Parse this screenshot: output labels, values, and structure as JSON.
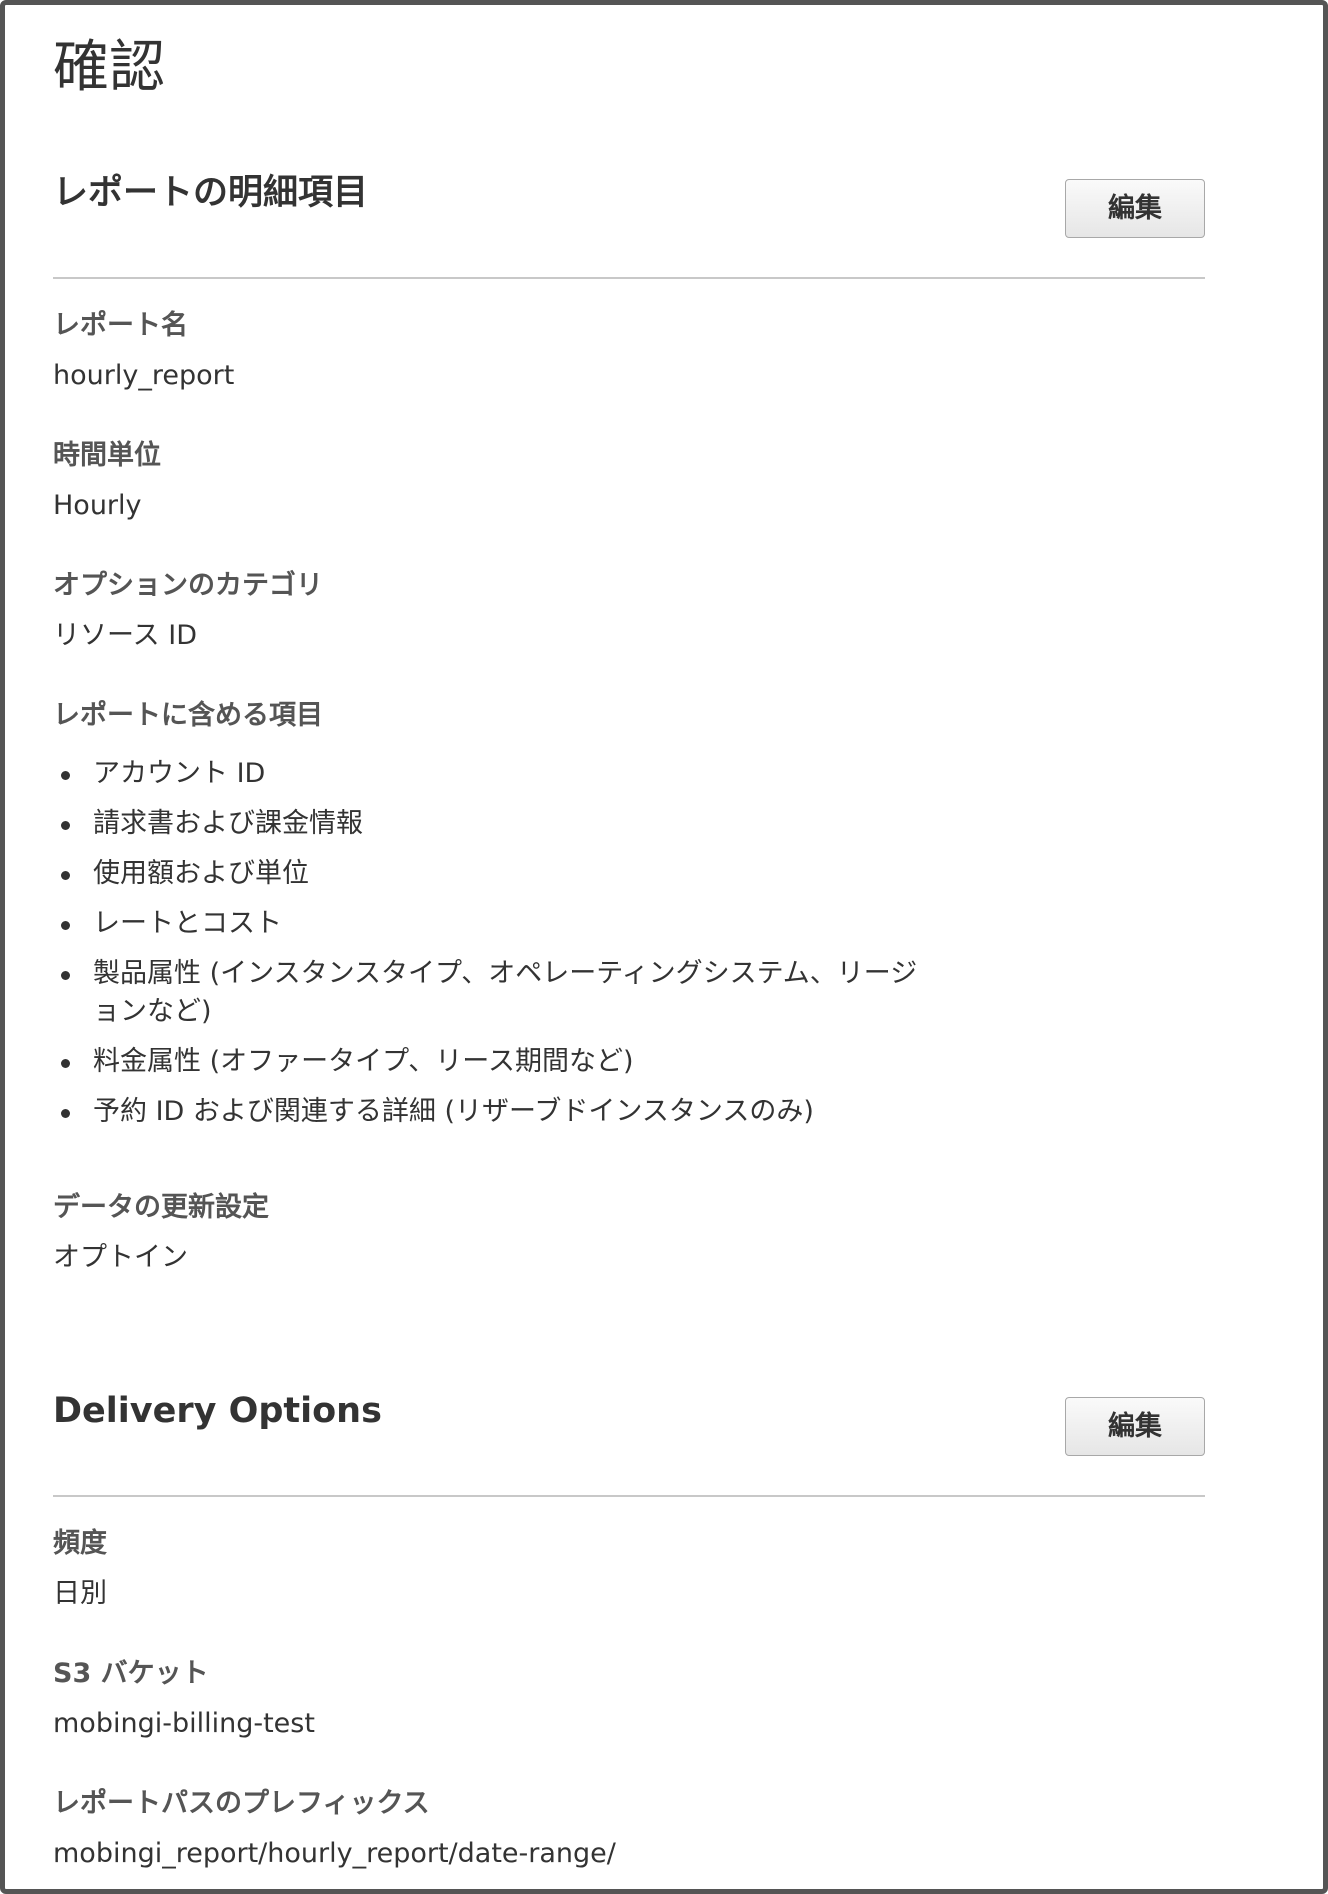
{
  "page": {
    "title": "確認"
  },
  "report_details": {
    "title": "レポートの明細項目",
    "edit_label": "編集",
    "fields": {
      "report_name": {
        "label": "レポート名",
        "value": "hourly_report"
      },
      "time_unit": {
        "label": "時間単位",
        "value": "Hourly"
      },
      "optional_category": {
        "label": "オプションのカテゴリ",
        "value": "リソース ID"
      },
      "included_items": {
        "label": "レポートに含める項目",
        "items": [
          "アカウント ID",
          "請求書および課金情報",
          "使用額および単位",
          "レートとコスト",
          "製品属性 (インスタンスタイプ、オペレーティングシステム、リージョンなど)",
          "料金属性 (オファータイプ、リース期間など)",
          "予約 ID および関連する詳細 (リザーブドインスタンスのみ)"
        ]
      },
      "data_refresh": {
        "label": "データの更新設定",
        "value": "オプトイン"
      }
    }
  },
  "delivery_options": {
    "title": "Delivery Options",
    "edit_label": "編集",
    "fields": {
      "frequency": {
        "label": "頻度",
        "value": "日別"
      },
      "s3_bucket": {
        "label": "S3 バケット",
        "value": "mobingi-billing-test"
      },
      "report_path_prefix": {
        "label": "レポートパスのプレフィックス",
        "value": "mobingi_report/hourly_report/date-range/"
      }
    }
  }
}
